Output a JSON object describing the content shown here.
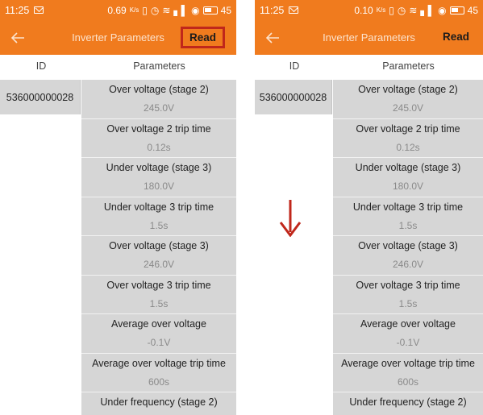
{
  "status": {
    "time": "11:25",
    "left_speed": "0.69",
    "right_speed": "0.10",
    "speed_unit": "K/s",
    "battery": "45"
  },
  "header": {
    "title": "Inverter Parameters",
    "read_label": "Read"
  },
  "table": {
    "col_id": "ID",
    "col_params": "Parameters",
    "device_id": "536000000028",
    "rows": [
      {
        "name": "Over voltage (stage 2)",
        "value": "245.0V"
      },
      {
        "name": "Over voltage 2 trip time",
        "value": "0.12s"
      },
      {
        "name": "Under voltage (stage 3)",
        "value": "180.0V"
      },
      {
        "name": "Under voltage 3 trip time",
        "value": "1.5s"
      },
      {
        "name": "Over voltage (stage 3)",
        "value": "246.0V"
      },
      {
        "name": "Over voltage 3 trip time",
        "value": "1.5s"
      },
      {
        "name": "Average over voltage",
        "value": "-0.1V"
      },
      {
        "name": "Average over voltage trip time",
        "value": "600s"
      },
      {
        "name": "Under frequency (stage 2)",
        "value": ""
      }
    ]
  },
  "colors": {
    "brand": "#f07b1e",
    "highlight_box": "#c0271b",
    "annotation_arrow": "#c0271b",
    "cell_bg": "#d6d6d6"
  }
}
